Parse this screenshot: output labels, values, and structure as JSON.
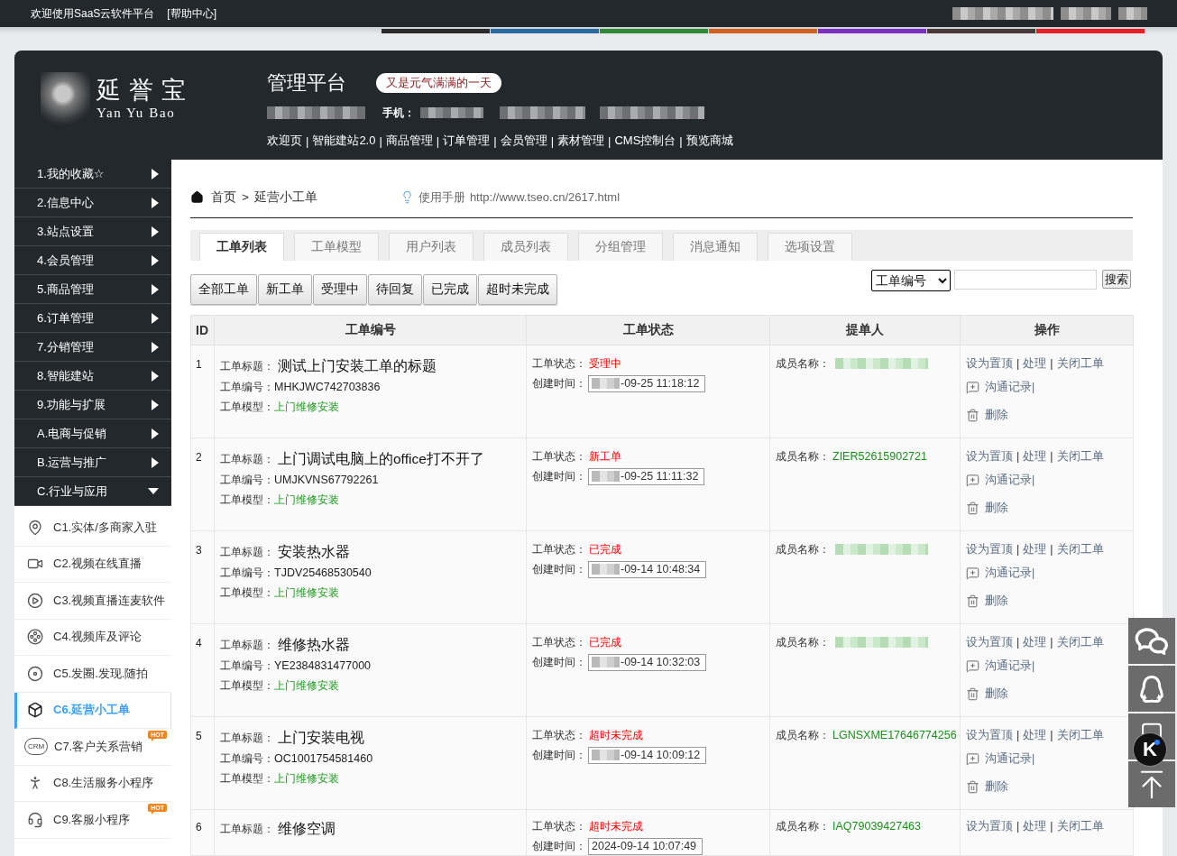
{
  "top_bar": {
    "welcome": "欢迎使用SaaS云软件平台",
    "help": "[帮助中心]"
  },
  "color_stripe": [
    {
      "color": "#2b2b2b"
    },
    {
      "color": "#2a6ba3"
    },
    {
      "color": "#2f8a37"
    },
    {
      "color": "#d3601b"
    },
    {
      "color": "#7a2ec2"
    },
    {
      "color": "#4a3937"
    },
    {
      "color": "#e81e25"
    }
  ],
  "header": {
    "logo": {
      "name": "延誉宝",
      "latin": "Yan Yu Bao"
    },
    "title": "管理平台",
    "greeting": "又是元气满满的一天",
    "phone_label": "手机：",
    "nav": [
      "欢迎页",
      "|",
      "智能建站2.0",
      "|",
      "商品管理",
      "|",
      "订单管理",
      "|",
      "会员管理",
      "|",
      "素材管理",
      "|",
      "CMS控制台",
      "|",
      "预览商城"
    ]
  },
  "sidebar": {
    "menu": [
      {
        "label": "1.我的收藏☆",
        "expanded": false
      },
      {
        "label": "2.信息中心",
        "expanded": false
      },
      {
        "label": "3.站点设置",
        "expanded": false
      },
      {
        "label": "4.会员管理",
        "expanded": false
      },
      {
        "label": "5.商品管理",
        "expanded": false
      },
      {
        "label": "6.订单管理",
        "expanded": false
      },
      {
        "label": "7.分销管理",
        "expanded": false
      },
      {
        "label": "8.智能建站",
        "expanded": false
      },
      {
        "label": "9.功能与扩展",
        "expanded": false
      },
      {
        "label": "A.电商与促销",
        "expanded": false
      },
      {
        "label": "B.运营与推广",
        "expanded": false
      },
      {
        "label": "C.行业与应用",
        "expanded": true,
        "children": [
          {
            "label": "C1.实体/多商家入驻",
            "selected": false
          },
          {
            "label": "C2.视频在线直播",
            "selected": false
          },
          {
            "label": "C3.视频直播连麦软件",
            "selected": false
          },
          {
            "label": "C4.视频库及评论",
            "selected": false
          },
          {
            "label": "C5.发圈.发现.随拍",
            "selected": false
          },
          {
            "label": "C6.延营小工单",
            "selected": true
          },
          {
            "label": "C7.客户关系营销",
            "selected": false,
            "badge": "HOT",
            "icon_text": "CRM"
          },
          {
            "label": "C8.生活服务小程序",
            "selected": false
          },
          {
            "label": "C9.客服小程序",
            "selected": false,
            "badge": "HOT"
          }
        ]
      }
    ]
  },
  "breadcrumb": {
    "home": "首页",
    "separator": ">",
    "current": "延营小工单"
  },
  "manual": {
    "label": "使用手册",
    "url": "http://www.tseo.cn/2617.html"
  },
  "tabs": [
    {
      "label": "工单列表",
      "selected": true
    },
    {
      "label": "工单模型",
      "selected": false
    },
    {
      "label": "用户列表",
      "selected": false
    },
    {
      "label": "成员列表",
      "selected": false
    },
    {
      "label": "分组管理",
      "selected": false
    },
    {
      "label": "消息通知",
      "selected": false
    },
    {
      "label": "选项设置",
      "selected": false
    }
  ],
  "filters": [
    "全部工单",
    "新工单",
    "受理中",
    "待回复",
    "已完成",
    "超时未完成"
  ],
  "search": {
    "field": "工单编号",
    "button": "搜索"
  },
  "table": {
    "columns": [
      "ID",
      "工单编号",
      "工单状态",
      "提单人",
      "操作"
    ],
    "rows": [
      {
        "id": "1",
        "title_label": "工单标题：",
        "title": "测试上门安装工单的标题",
        "code_label": "工单编号：",
        "code": "MHKJWC742703836",
        "model_label": "工单模型：",
        "model": "上门维修安装",
        "status_label": "工单状态：",
        "status": "受理中",
        "created_label": "创建时间：",
        "created": "-09-25 11:18:12",
        "year_hidden": true,
        "member_label": "成员名称：",
        "member_hidden": true,
        "actions": [
          "设为置顶",
          "|",
          "处理",
          "|",
          "关闭工单"
        ],
        "chat": "沟通记录|",
        "delete": "删除"
      },
      {
        "id": "2",
        "title_label": "工单标题：",
        "title": "上门调试电脑上的office打不开了",
        "code_label": "工单编号：",
        "code": "UMJKVNS67792261",
        "model_label": "工单模型：",
        "model": "上门维修安装",
        "status_label": "工单状态：",
        "status": "新工单",
        "created_label": "创建时间：",
        "created": "-09-25 11:11:32",
        "year_hidden": true,
        "member_label": "成员名称：",
        "member_hidden": false,
        "member": "ZIER52615902721",
        "actions": [
          "设为置顶",
          "|",
          "处理",
          "|",
          "关闭工单"
        ],
        "chat": "沟通记录|",
        "delete": "删除"
      },
      {
        "id": "3",
        "title_label": "工单标题：",
        "title": "安装热水器",
        "code_label": "工单编号：",
        "code": "TJDV25468530540",
        "model_label": "工单模型：",
        "model": "上门维修安装",
        "status_label": "工单状态：",
        "status": "已完成",
        "created_label": "创建时间：",
        "created": "-09-14 10:48:34",
        "year_hidden": true,
        "member_label": "成员名称：",
        "member_hidden": true,
        "actions": [
          "设为置顶",
          "|",
          "处理",
          "|",
          "关闭工单"
        ],
        "chat": "沟通记录|",
        "delete": "删除"
      },
      {
        "id": "4",
        "title_label": "工单标题：",
        "title": "维修热水器",
        "code_label": "工单编号：",
        "code": "YE2384831477000",
        "model_label": "工单模型：",
        "model": "上门维修安装",
        "status_label": "工单状态：",
        "status": "已完成",
        "created_label": "创建时间：",
        "created": "-09-14 10:32:03",
        "year_hidden": true,
        "member_label": "成员名称：",
        "member_hidden": true,
        "actions": [
          "设为置顶",
          "|",
          "处理",
          "|",
          "关闭工单"
        ],
        "chat": "沟通记录|",
        "delete": "删除"
      },
      {
        "id": "5",
        "title_label": "工单标题：",
        "title": "上门安装电视",
        "code_label": "工单编号：",
        "code": "OC1001754581460",
        "model_label": "工单模型：",
        "model": "上门维修安装",
        "status_label": "工单状态：",
        "status": "超时未完成",
        "created_label": "创建时间：",
        "created": "-09-14 10:09:12",
        "year_hidden": true,
        "member_label": "成员名称：",
        "member_hidden": false,
        "member": "LGNSXME17646774256",
        "actions": [
          "设为置顶",
          "|",
          "处理",
          "|",
          "关闭工单"
        ],
        "chat": "沟通记录|",
        "delete": "删除"
      },
      {
        "id": "6",
        "title_label": "工单标题：",
        "title": "维修空调",
        "status_label": "工单状态：",
        "status": "超时未完成",
        "created_label": "创建时间：",
        "created": "2024-09-14 10:07:49",
        "year_hidden": false,
        "member_label": "成员名称：",
        "member_hidden": false,
        "member": "IAQ79039427463",
        "actions": [
          "设为置顶",
          "|",
          "处理",
          "|",
          "关闭工单"
        ]
      }
    ]
  },
  "float_toolbar": {
    "badge": "K"
  }
}
